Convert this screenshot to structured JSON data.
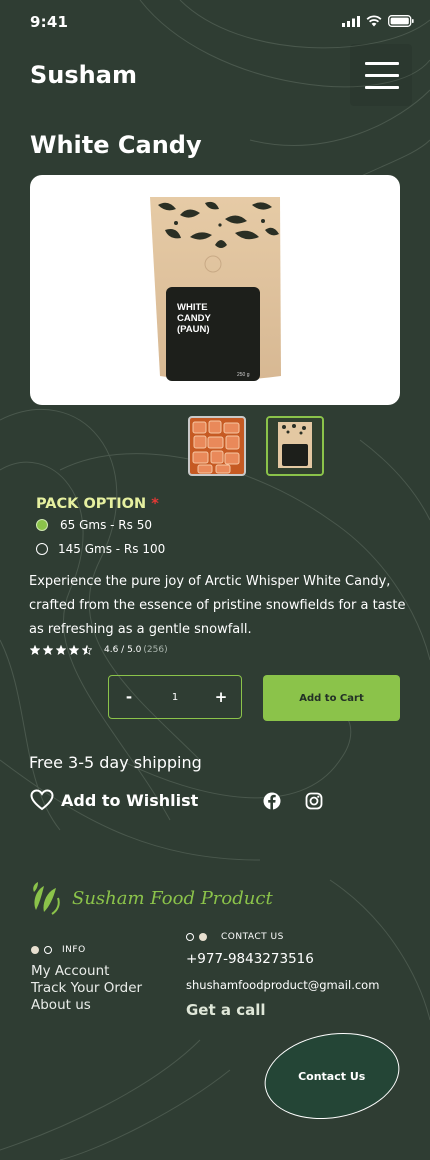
{
  "status_bar": {
    "time": "9:41"
  },
  "header": {
    "brand": "Susham",
    "menu_icon": "hamburger-menu-icon"
  },
  "product": {
    "title": "White Candy",
    "package_label": "WHITE\nCANDY\n(PAUN)",
    "package_weight": "250 g",
    "pack_option": {
      "label": "PACK OPTION",
      "required_mark": "*",
      "options": [
        {
          "label": "65 Gms - Rs 50",
          "selected": true
        },
        {
          "label": "145 Gms - Rs 100",
          "selected": false
        }
      ]
    },
    "description": "Experience the pure joy of Arctic Whisper White Candy, crafted from the essence of pristine snowfields for a taste as refreshing as a gentle snowfall.",
    "rating": {
      "stars": 4.5,
      "score": "4.6 / 5.0",
      "count": "(256)"
    },
    "quantity": {
      "minus": "-",
      "value": "1",
      "plus": "+"
    },
    "add_to_cart": "Add to Cart",
    "shipping": "Free 3-5 day shipping",
    "wishlist": "Add to Wishlist",
    "social_icons": [
      "facebook-icon",
      "instagram-icon"
    ]
  },
  "footer": {
    "company": "Susham Food Product",
    "info": {
      "label": "INFO",
      "links": [
        "My Account",
        "Track Your Order",
        "About us"
      ]
    },
    "contact": {
      "label": "CONTACT US",
      "phone": "+977-9843273516",
      "email": "shushamfoodproduct@gmail.com",
      "call": "Get a call"
    },
    "contact_button": "Contact Us"
  },
  "colors": {
    "background": "#2f3d33",
    "accent": "#8bc34a",
    "pack_title": "#e6f0a0",
    "required": "#e53935"
  }
}
